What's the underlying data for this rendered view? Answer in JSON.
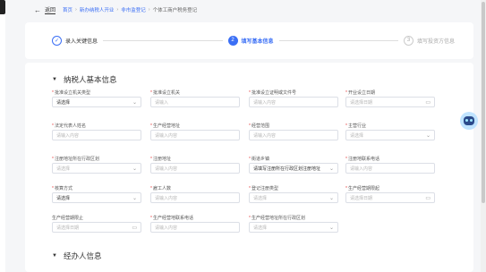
{
  "topbar": {
    "back_label": "返回",
    "breadcrumbs": [
      "首页",
      "新办纳税人开业",
      "非市监登记",
      "个体工商户税务登记"
    ]
  },
  "steps": [
    {
      "label": "录入关键信息",
      "marker": "✓",
      "state": "done"
    },
    {
      "label": "填写基本信息",
      "marker": "2",
      "state": "active"
    },
    {
      "label": "填写投资方信息",
      "marker": "3",
      "state": "pending"
    }
  ],
  "sections": {
    "taxpayer_title": "纳税人基本信息",
    "agent_title": "经办人信息"
  },
  "fields": [
    {
      "label": "批准设立机关类型",
      "required": true,
      "value": "请选择",
      "filled": true,
      "icon": "chevron-down"
    },
    {
      "label": "批准设立机关",
      "required": true,
      "value": "请输入",
      "filled": false,
      "icon": ""
    },
    {
      "label": "批准设立证明或文件号",
      "required": true,
      "value": "请输入内容",
      "filled": false,
      "icon": ""
    },
    {
      "label": "开业设立日期",
      "required": true,
      "value": "请选择日期",
      "filled": false,
      "icon": "calendar"
    },
    {
      "label": "法定代表人姓名",
      "required": true,
      "value": "请输入内容",
      "filled": false,
      "icon": ""
    },
    {
      "label": "生产经营地址",
      "required": true,
      "value": "请输入内容",
      "filled": false,
      "icon": ""
    },
    {
      "label": "经营范围",
      "required": true,
      "value": "请输入内容",
      "filled": false,
      "icon": ""
    },
    {
      "label": "主营行业",
      "required": true,
      "value": "请选择",
      "filled": false,
      "icon": "chevron-down"
    },
    {
      "label": "注册地址所在行政区划",
      "required": true,
      "value": "请选择",
      "filled": false,
      "icon": "chevron-down"
    },
    {
      "label": "注册地址",
      "required": true,
      "value": "请输入内容",
      "filled": false,
      "icon": ""
    },
    {
      "label": "街道乡镇",
      "required": true,
      "value": "请填写注册所在行政区划注册地址",
      "filled": true,
      "icon": "chevron-down"
    },
    {
      "label": "注册地联系电话",
      "required": true,
      "value": "请输入内容",
      "filled": false,
      "icon": ""
    },
    {
      "label": "核算方式",
      "required": true,
      "value": "请选择",
      "filled": true,
      "icon": "chevron-down"
    },
    {
      "label": "雇工人数",
      "required": true,
      "value": "请输入内容",
      "filled": false,
      "icon": ""
    },
    {
      "label": "登记注册类型",
      "required": true,
      "value": "请选择",
      "filled": false,
      "icon": "chevron-down"
    },
    {
      "label": "生产经营期限起",
      "required": true,
      "value": "请选择日期",
      "filled": false,
      "icon": "calendar"
    },
    {
      "label": "生产经营期限止",
      "required": false,
      "value": "请选择日期",
      "filled": false,
      "icon": "calendar"
    },
    {
      "label": "生产经营地联系电话",
      "required": true,
      "value": "请输入内容",
      "filled": false,
      "icon": ""
    },
    {
      "label": "生产经营地址所在行政区划",
      "required": true,
      "value": "请选择",
      "filled": false,
      "icon": "chevron-down"
    }
  ],
  "colors": {
    "accent": "#3b6ff5",
    "required": "#e54545"
  }
}
